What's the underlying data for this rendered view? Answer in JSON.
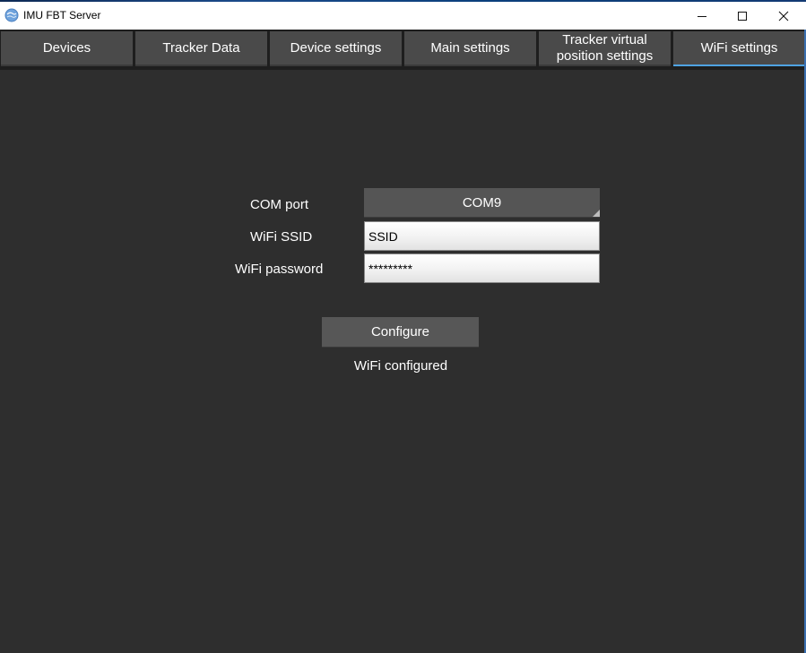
{
  "window": {
    "title": "IMU FBT Server",
    "icon": "app-globe-icon"
  },
  "tabs": [
    {
      "label": "Devices",
      "active": false
    },
    {
      "label": "Tracker Data",
      "active": false
    },
    {
      "label": "Device settings",
      "active": false
    },
    {
      "label": "Main settings",
      "active": false
    },
    {
      "label": "Tracker virtual\nposition settings",
      "active": false
    },
    {
      "label": "WiFi settings",
      "active": true
    }
  ],
  "form": {
    "com_port_label": "COM port",
    "com_port_value": "COM9",
    "ssid_label": "WiFi SSID",
    "ssid_value": "SSID",
    "password_label": "WiFi password",
    "password_value": "*********",
    "configure_label": "Configure",
    "status_text": "WiFi configured"
  },
  "colors": {
    "background": "#2e2e2e",
    "tab": "#4a4a4a",
    "active_tab_accent": "#4fa3e3",
    "button": "#575757"
  }
}
